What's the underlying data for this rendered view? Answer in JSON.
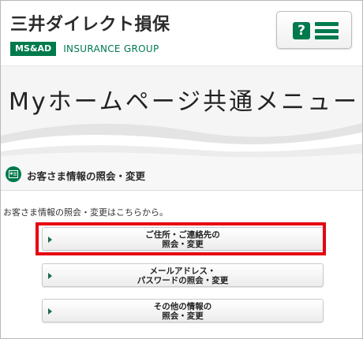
{
  "header": {
    "brand_name": "三井ダイレクト損保",
    "group_badge": "MS&AD",
    "group_text": "INSURANCE GROUP",
    "help_icon": "?",
    "menu_icon": "hamburger-icon"
  },
  "page": {
    "title": "Myホームページ共通メニュー"
  },
  "section": {
    "icon": "id-card-icon",
    "title": "お客さま情報の照会・変更",
    "description": "お客さま情報の照会・変更はこちらから。"
  },
  "buttons": [
    {
      "line1": "ご住所・ご連絡先の",
      "line2": "照会・変更",
      "highlighted": true
    },
    {
      "line1": "メールアドレス・",
      "line2": "パスワードの照会・変更",
      "highlighted": false
    },
    {
      "line1": "その他の情報の",
      "line2": "照会・変更",
      "highlighted": false
    }
  ],
  "colors": {
    "brand_green": "#007a4d",
    "highlight_red": "#e60012"
  }
}
